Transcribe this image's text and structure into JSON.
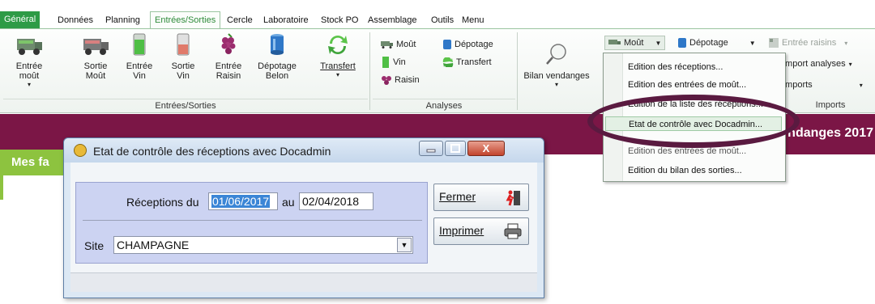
{
  "menu": {
    "tabs": [
      "Général",
      "Données",
      "Planning",
      "Entrées/Sorties",
      "Cercle",
      "Laboratoire",
      "Stock PO",
      "Assemblage",
      "Outils",
      "Menu"
    ],
    "active_index": 3
  },
  "ribbon": {
    "entrees_sorties": {
      "buttons": [
        {
          "label": "Entrée moût",
          "dropdown": "▾",
          "icon": "truck-green-icon"
        },
        {
          "label": "Sortie\nMoût",
          "icon": "truck-red-icon"
        },
        {
          "label": "Entrée\nVin",
          "icon": "tank-green-icon"
        },
        {
          "label": "Sortie\nVin",
          "icon": "tank-red-icon"
        },
        {
          "label": "Entrée\nRaisin",
          "icon": "grape-icon"
        },
        {
          "label": "Dépotage\nBelon",
          "icon": "barrel-icon"
        },
        {
          "label": "Transfert",
          "dropdown": "▾",
          "icon": "transfer-arrows-icon"
        }
      ],
      "footer": "Entrées/Sorties"
    },
    "analyses": {
      "small": [
        "Moût",
        "Vin",
        "Raisin",
        "Dépotage",
        "Transfert"
      ],
      "footer": "Analyses"
    },
    "bilan": {
      "label": "Bilan vendanges",
      "dropdown": "▾"
    },
    "right_top": {
      "mout": "Moût",
      "depotage": "Dépotage",
      "entree_raisins": "Entrée raisins",
      "import_analyses": "Import analyses",
      "imports": "Imports",
      "footer": "Imports"
    }
  },
  "dropdown": {
    "items": [
      "Edition des réceptions...",
      "Edition des entrées de moût...",
      "Edition de la liste des réceptions...",
      "Etat de contrôle avec Docadmin...",
      "Edition des entrées de moût...",
      "Edition du bilan des sorties..."
    ],
    "highlighted_index": 3
  },
  "banner": {
    "text": "ndanges 2017",
    "partial_label": "Mes fa"
  },
  "dialog": {
    "title": "Etat de contrôle des réceptions avec Docadmin",
    "receptions_label": "Réceptions du",
    "date_from": "01/06/2017",
    "au_label": "au",
    "date_to": "02/04/2018",
    "site_label": "Site",
    "site_value": "CHAMPAGNE",
    "fermer": "Fermer",
    "imprimer": "Imprimer",
    "close_glyph": "X"
  },
  "colors": {
    "accent": "#2e9b46",
    "band": "#7b1646",
    "lime": "#8dc33f",
    "highlight": "#3b86d6"
  }
}
